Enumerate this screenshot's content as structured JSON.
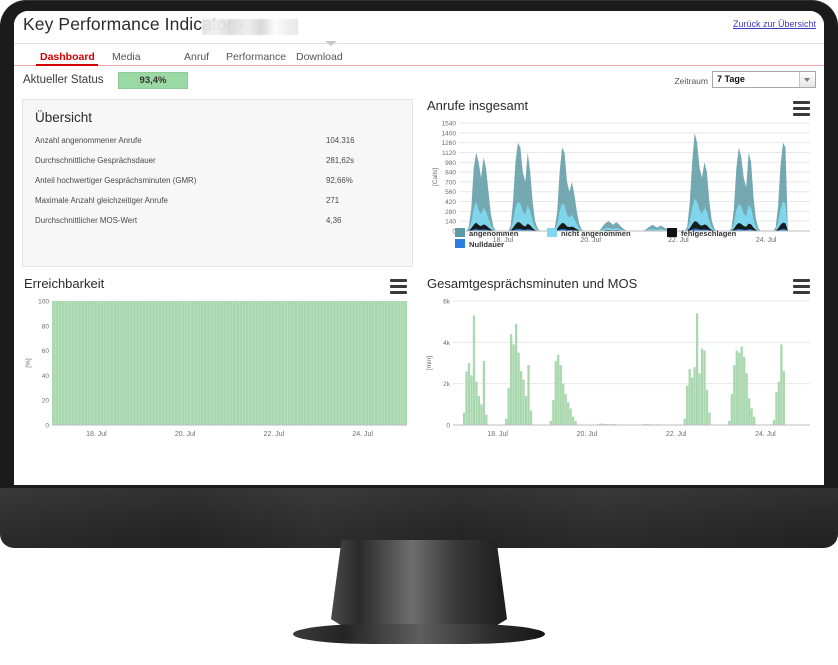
{
  "app": {
    "title": "Key Performance Indicator -",
    "back_link": "Zurück zur Übersicht"
  },
  "tabs": [
    {
      "label": "Dashboard",
      "active": true
    },
    {
      "label": "Media",
      "active": false
    },
    {
      "label": "Anruf",
      "active": false
    },
    {
      "label": "Performance",
      "active": false
    },
    {
      "label": "Download",
      "active": false
    }
  ],
  "status": {
    "label": "Aktueller Status",
    "value": "93,4%",
    "pill_color": "#9bd9a4"
  },
  "timerange": {
    "label": "Zeitraum",
    "selected": "7 Tage",
    "options": [
      "7 Tage"
    ]
  },
  "overview": {
    "title": "Übersicht",
    "rows": [
      {
        "label": "Anzahl angenommener Anrufe",
        "value": "104.316"
      },
      {
        "label": "Durchschnittliche Gesprächsdauer",
        "value": "281,62s"
      },
      {
        "label": "Anteil hochwertiger Gesprächsminuten (GMR)",
        "value": "92,66%"
      },
      {
        "label": "Maximale Anzahl gleichzeitiger Anrufe",
        "value": "271"
      },
      {
        "label": "Durchschnittlicher MOS-Wert",
        "value": "4,36"
      }
    ]
  },
  "chart_data": [
    {
      "type": "area",
      "id": "calls",
      "title": "Anrufe insgesamt",
      "ylabel": "[Calls]",
      "xlabel": "",
      "ylim": [
        0,
        1540
      ],
      "yticks": [
        0,
        140,
        280,
        420,
        560,
        700,
        840,
        980,
        1120,
        1260,
        1400,
        1540
      ],
      "xticks": [
        "18. Jul",
        "20. Jul",
        "22. Jul",
        "24. Jul"
      ],
      "grid": true,
      "legend_position": "bottom",
      "legend": [
        "angenommen",
        "nicht angenommen",
        "fehlgeschlagen",
        "Nulldauer"
      ],
      "colors": {
        "angenommen": "#5c9aa5",
        "nicht angenommen": "#7fd8ef",
        "fehlgeschlagen": "#111111",
        "Nulldauer": "#2a7fe0"
      },
      "series": [
        {
          "name": "angenommen",
          "values": [
            0,
            0,
            0,
            0,
            60,
            320,
            900,
            1120,
            980,
            760,
            1050,
            900,
            560,
            240,
            60,
            0,
            0,
            0,
            0,
            0,
            0,
            60,
            420,
            980,
            1260,
            1190,
            840,
            700,
            1120,
            840,
            420,
            140,
            40,
            0,
            0,
            0,
            0,
            0,
            0,
            40,
            280,
            840,
            1190,
            1120,
            700,
            560,
            700,
            520,
            280,
            100,
            20,
            0,
            0,
            0,
            0,
            0,
            0,
            0,
            40,
            90,
            120,
            140,
            110,
            90,
            130,
            100,
            60,
            30,
            10,
            0,
            0,
            0,
            0,
            0,
            0,
            0,
            20,
            50,
            70,
            90,
            60,
            50,
            80,
            60,
            40,
            20,
            10,
            0,
            0,
            0,
            0,
            0,
            0,
            60,
            400,
            980,
            1400,
            1260,
            900,
            760,
            980,
            840,
            420,
            140,
            40,
            0,
            0,
            0,
            0,
            0,
            0,
            40,
            320,
            900,
            1190,
            1050,
            760,
            620,
            1120,
            980,
            480,
            160,
            40,
            0,
            0,
            0,
            0,
            0,
            0,
            50,
            360,
            940,
            1260,
            1190,
            0,
            0,
            0,
            0,
            0,
            0,
            0,
            0,
            0,
            0
          ]
        },
        {
          "name": "nicht angenommen",
          "values": [
            0,
            0,
            0,
            0,
            30,
            120,
            320,
            420,
            300,
            240,
            330,
            280,
            180,
            80,
            20,
            0,
            0,
            0,
            0,
            0,
            0,
            20,
            140,
            330,
            420,
            390,
            280,
            230,
            370,
            280,
            140,
            50,
            15,
            0,
            0,
            0,
            0,
            0,
            0,
            15,
            100,
            280,
            390,
            370,
            230,
            190,
            230,
            170,
            95,
            35,
            8,
            0,
            0,
            0,
            0,
            0,
            0,
            0,
            15,
            30,
            40,
            45,
            35,
            30,
            42,
            33,
            20,
            10,
            4,
            0,
            0,
            0,
            0,
            0,
            0,
            0,
            8,
            18,
            25,
            30,
            20,
            18,
            28,
            20,
            14,
            7,
            3,
            0,
            0,
            0,
            0,
            0,
            0,
            20,
            130,
            330,
            460,
            420,
            300,
            250,
            330,
            280,
            140,
            50,
            15,
            0,
            0,
            0,
            0,
            0,
            0,
            15,
            110,
            300,
            390,
            350,
            250,
            210,
            370,
            330,
            160,
            55,
            15,
            0,
            0,
            0,
            0,
            0,
            0,
            18,
            120,
            310,
            420,
            390,
            0,
            0,
            0,
            0,
            0,
            0,
            0,
            0,
            0,
            0
          ]
        },
        {
          "name": "fehlgeschlagen",
          "values": [
            0,
            0,
            0,
            0,
            10,
            40,
            90,
            120,
            85,
            70,
            95,
            80,
            50,
            22,
            6,
            0,
            0,
            0,
            0,
            0,
            0,
            6,
            45,
            95,
            130,
            115,
            80,
            65,
            105,
            80,
            40,
            14,
            4,
            0,
            0,
            0,
            0,
            0,
            0,
            4,
            30,
            80,
            115,
            105,
            65,
            55,
            65,
            48,
            27,
            10,
            2,
            0,
            0,
            0,
            0,
            0,
            0,
            0,
            4,
            9,
            12,
            14,
            10,
            9,
            13,
            10,
            6,
            3,
            1,
            0,
            0,
            0,
            0,
            0,
            0,
            0,
            2,
            5,
            7,
            9,
            6,
            5,
            8,
            6,
            4,
            2,
            1,
            0,
            0,
            0,
            0,
            0,
            0,
            6,
            40,
            95,
            140,
            130,
            90,
            75,
            95,
            80,
            40,
            14,
            4,
            0,
            0,
            0,
            0,
            0,
            0,
            4,
            32,
            85,
            115,
            100,
            72,
            60,
            105,
            95,
            46,
            16,
            4,
            0,
            0,
            0,
            0,
            0,
            0,
            5,
            35,
            90,
            120,
            110,
            0,
            0,
            0,
            0,
            0,
            0,
            0,
            0,
            0,
            0
          ]
        },
        {
          "name": "Nulldauer",
          "values": [
            0,
            0,
            0,
            0,
            3,
            10,
            22,
            30,
            20,
            16,
            24,
            20,
            12,
            5,
            1,
            0,
            0,
            0,
            0,
            0,
            0,
            1,
            11,
            24,
            32,
            28,
            20,
            16,
            26,
            20,
            10,
            3,
            1,
            0,
            0,
            0,
            0,
            0,
            0,
            1,
            7,
            20,
            28,
            26,
            16,
            13,
            16,
            12,
            6,
            2,
            0,
            0,
            0,
            0,
            0,
            0,
            0,
            0,
            1,
            2,
            3,
            3,
            2,
            2,
            3,
            2,
            1,
            0,
            0,
            0,
            0,
            0,
            0,
            0,
            0,
            0,
            0,
            1,
            1,
            2,
            1,
            1,
            2,
            1,
            1,
            0,
            0,
            0,
            0,
            0,
            0,
            0,
            0,
            1,
            10,
            24,
            35,
            32,
            22,
            18,
            24,
            20,
            10,
            3,
            1,
            0,
            0,
            0,
            0,
            0,
            0,
            1,
            8,
            21,
            28,
            25,
            18,
            15,
            26,
            23,
            11,
            4,
            1,
            0,
            0,
            0,
            0,
            0,
            0,
            1,
            9,
            22,
            30,
            27,
            0,
            0,
            0,
            0,
            0,
            0,
            0,
            0,
            0,
            0
          ]
        }
      ]
    },
    {
      "type": "area",
      "id": "reachability",
      "title": "Erreichbarkeit",
      "ylabel": "[%]",
      "xlabel": "",
      "ylim": [
        0,
        100
      ],
      "yticks": [
        0,
        20,
        40,
        60,
        80,
        100
      ],
      "xticks": [
        "18. Jul",
        "20. Jul",
        "22. Jul",
        "24. Jul"
      ],
      "grid": false,
      "color": "#a9d8af",
      "series": [
        {
          "name": "Erreichbarkeit",
          "constant_value": 100,
          "note": "durchgehend 100% über den gesamten Zeitraum"
        }
      ]
    },
    {
      "type": "bar",
      "id": "talkminutes",
      "title": "Gesamtgesprächsminuten und MOS",
      "ylabel": "[min]",
      "xlabel": "",
      "ylim": [
        0,
        6000
      ],
      "yticks": [
        0,
        2000,
        4000,
        6000
      ],
      "ytick_labels": [
        "0",
        "2k",
        "4k",
        "6k"
      ],
      "xticks": [
        "18. Jul",
        "20. Jul",
        "22. Jul",
        "24. Jul"
      ],
      "grid": true,
      "color": "#a9d8af",
      "series": [
        {
          "name": "Gesprächsminuten",
          "values": [
            0,
            0,
            0,
            0,
            600,
            2600,
            3000,
            2400,
            5300,
            2100,
            1400,
            1000,
            3100,
            500,
            0,
            0,
            0,
            0,
            0,
            0,
            0,
            300,
            1800,
            4400,
            3900,
            4900,
            3500,
            2600,
            2200,
            1400,
            2900,
            700,
            0,
            0,
            0,
            0,
            0,
            0,
            0,
            200,
            1200,
            3100,
            3400,
            2900,
            2000,
            1500,
            1100,
            800,
            400,
            200,
            0,
            0,
            0,
            0,
            0,
            0,
            0,
            0,
            40,
            70,
            60,
            50,
            40,
            30,
            50,
            40,
            20,
            10,
            0,
            0,
            0,
            0,
            0,
            0,
            0,
            0,
            30,
            50,
            40,
            35,
            30,
            25,
            35,
            30,
            15,
            8,
            0,
            0,
            0,
            0,
            0,
            0,
            0,
            300,
            1900,
            2700,
            2300,
            2800,
            5400,
            2500,
            3700,
            3600,
            1700,
            600,
            0,
            0,
            0,
            0,
            0,
            0,
            0,
            200,
            1500,
            2900,
            3600,
            3500,
            3800,
            3300,
            2500,
            1300,
            800,
            400,
            0,
            0,
            0,
            0,
            0,
            0,
            0,
            250,
            1600,
            2100,
            3900,
            2600,
            0,
            0,
            0,
            0,
            0,
            0,
            0,
            0,
            0,
            0
          ]
        }
      ]
    }
  ]
}
